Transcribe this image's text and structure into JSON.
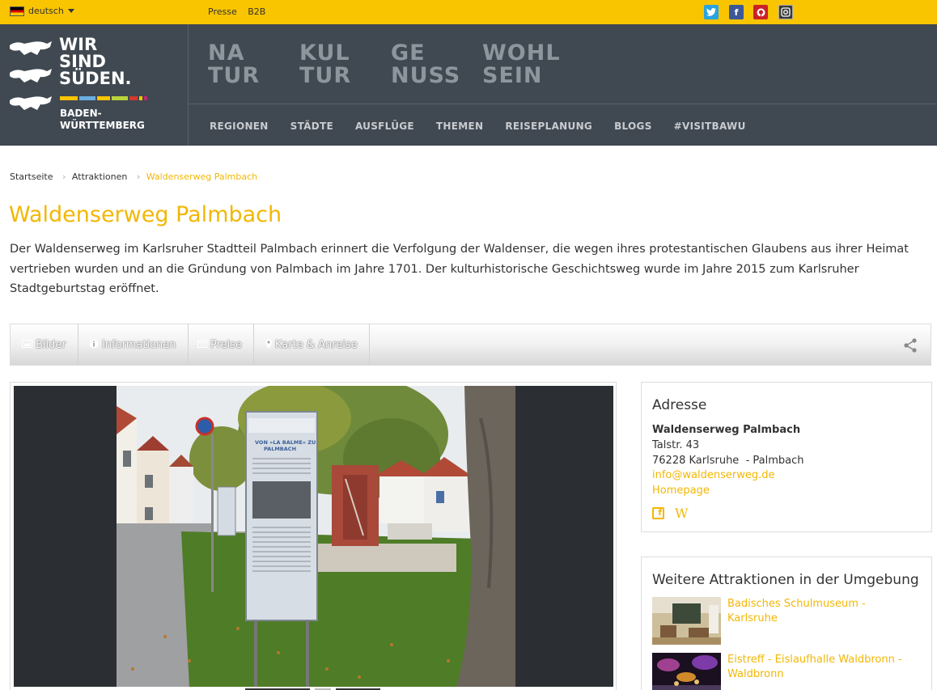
{
  "topbar": {
    "language": "deutsch",
    "links": [
      "Presse",
      "B2B"
    ],
    "social_icons": [
      "twitter-icon",
      "facebook-icon",
      "pinterest-icon",
      "instagram-icon"
    ]
  },
  "logo": {
    "line1": "WIR",
    "line2": "SIND",
    "line3": "SÜDEN.",
    "region1": "BADEN-",
    "region2": "WÜRTTEMBERG"
  },
  "main_nav": [
    {
      "line1": "NA",
      "line2": "TUR"
    },
    {
      "line1": "KUL",
      "line2": "TUR"
    },
    {
      "line1": "GE",
      "line2": "NUSS"
    },
    {
      "line1": "WOHL",
      "line2": "SEIN"
    }
  ],
  "sub_nav": [
    "REGIONEN",
    "STÄDTE",
    "AUSFLÜGE",
    "THEMEN",
    "REISEPLANUNG",
    "BLOGS",
    "#VISITBAWU"
  ],
  "breadcrumb": {
    "home": "Startseite",
    "section": "Attraktionen",
    "separator": "›",
    "current": "Waldenserweg Palmbach"
  },
  "page": {
    "title": "Waldenserweg Palmbach",
    "intro": "Der Waldenserweg im Karlsruher Stadtteil Palmbach erinnert die Verfolgung der Waldenser, die wegen ihres protestantischen Glaubens aus ihrer Heimat vertrieben wurden und an die Gründung von Palmbach im Jahre 1701. Der kulturhistorische Geschichtsweg wurde im Jahre 2015 zum Karlsruher Stadtgeburtstag eröffnet."
  },
  "tabs": [
    {
      "label": "Bilder",
      "icon": "image-icon"
    },
    {
      "label": "Informationen",
      "icon": "info-icon"
    },
    {
      "label": "Preise",
      "icon": "calendar-icon"
    },
    {
      "label": "Karte & Anreise",
      "icon": "map-pin-icon"
    }
  ],
  "sign_text": {
    "title1": "VON »LA BALME« ZU",
    "title2": "PALMBACH"
  },
  "address": {
    "heading": "Adresse",
    "name": "Waldenserweg Palmbach",
    "street": "Talstr. 43",
    "city": "76228 Karlsruhe  - Palmbach",
    "email": "info@waldenserweg.de",
    "homepage": "Homepage"
  },
  "nearby": {
    "heading": "Weitere Attraktionen in der Umgebung",
    "items": [
      {
        "label": "Badisches Schulmuseum - Karlsruhe"
      },
      {
        "label": "Eistreff - Eislaufhalle Waldbronn - Waldbronn"
      }
    ]
  },
  "colors": {
    "accent": "#f2b705",
    "topbar": "#f9c400",
    "header": "#404851"
  }
}
